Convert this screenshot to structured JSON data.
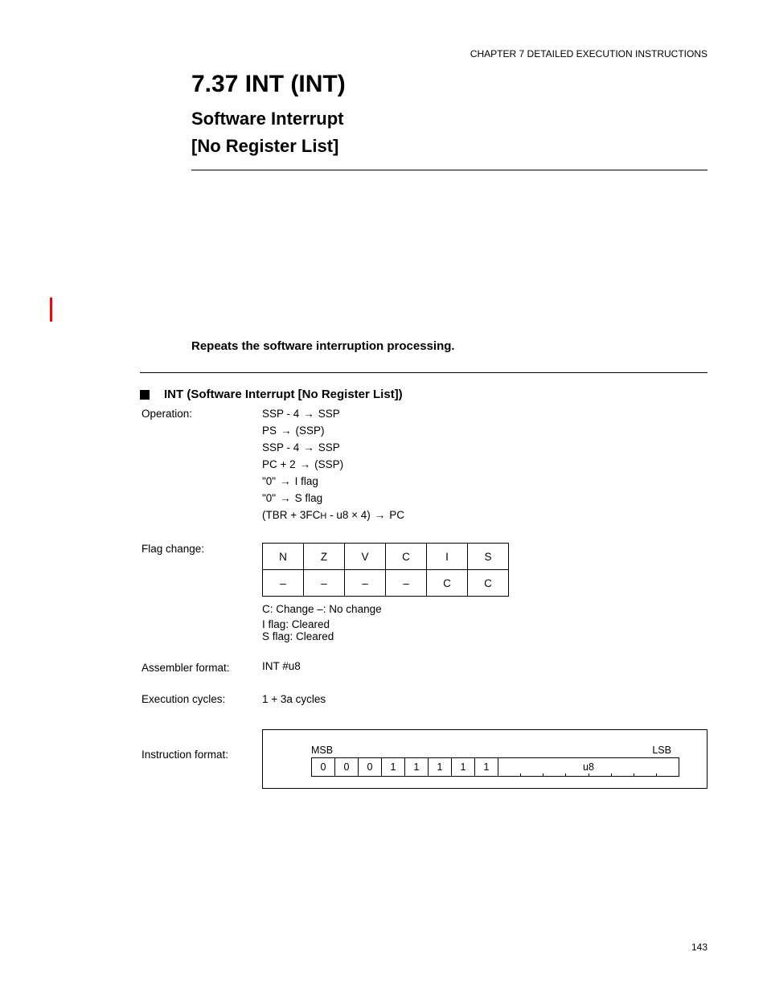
{
  "page_number": "143",
  "section_path": "CHAPTER 7  DETAILED EXECUTION INSTRUCTIONS",
  "mnemonic": "7.37  INT (INT)",
  "title_line1": "Software Interrupt",
  "title_line2": "[No Register List]",
  "summary_desc": "Repeats the software interruption processing.",
  "sec_int": {
    "heading": "INT (Software Interrupt [No Register List])",
    "operation_label": "Operation:",
    "operations": [
      "SSP - 4 → SSP, PS → (SSP)",
      "SSP - 4 → SSP, PC + 2 → (SSP)",
      "\"0\" → I flag",
      "\"0\" → S flag",
      "(TBR + 3FCH - u8 × 4) → PC"
    ],
    "assembler_label": "Assembler format:",
    "assembler_value": "INT #u8",
    "flag_label": "Flag change:",
    "flags": {
      "headers": [
        "N",
        "Z",
        "V",
        "C",
        "I",
        "S"
      ],
      "values": [
        "–",
        "–",
        "–",
        "–",
        "C",
        "C"
      ]
    },
    "flag_legend": "C: Change  –: No change",
    "flag_notes": [
      "I flag: Cleared",
      "S flag: Cleared"
    ],
    "cycles_label": "Execution cycles:",
    "cycles_value": "1 + 3a cycles",
    "format_label": "Instruction format:",
    "bit_labels": {
      "msb": "MSB",
      "lsb": "LSB"
    },
    "opcode_bits": [
      "0",
      "0",
      "0",
      "1",
      "1",
      "1",
      "1",
      "1"
    ],
    "operand_field": "u8"
  }
}
